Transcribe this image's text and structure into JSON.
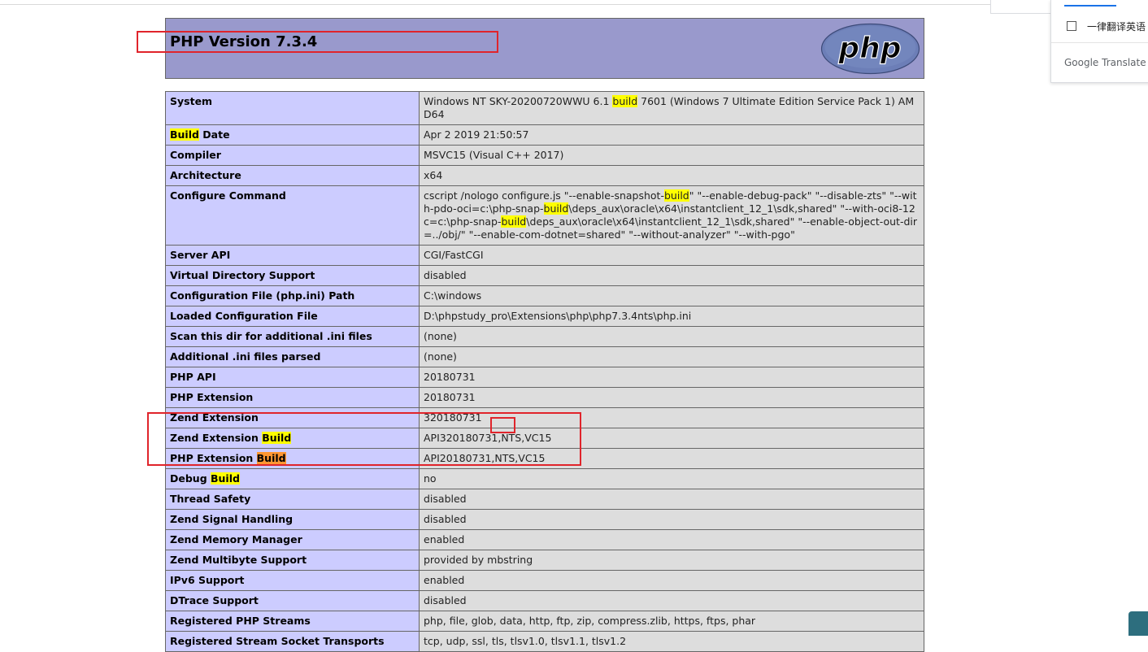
{
  "header": {
    "title": "PHP Version 7.3.4",
    "logo_text": "php"
  },
  "rows": [
    {
      "key": "System",
      "val": [
        {
          "t": "Windows NT SKY-20200720WWU 6.1 "
        },
        {
          "t": "build",
          "h": 1
        },
        {
          "t": " 7601 (Windows 7 Ultimate Edition Service Pack 1) AMD64"
        }
      ]
    },
    {
      "key": [
        {
          "t": "Build",
          "h": 1
        },
        {
          "t": " Date"
        }
      ],
      "val": "Apr 2 2019 21:50:57"
    },
    {
      "key": "Compiler",
      "val": "MSVC15 (Visual C++ 2017)"
    },
    {
      "key": "Architecture",
      "val": "x64"
    },
    {
      "key": "Configure Command",
      "val": [
        {
          "t": "cscript /nologo configure.js \"--enable-snapshot-"
        },
        {
          "t": "build",
          "h": 1
        },
        {
          "t": "\" \"--enable-debug-pack\" \"--disable-zts\" \"--with-pdo-oci=c:\\php-snap-"
        },
        {
          "t": "build",
          "h": 1
        },
        {
          "t": "\\deps_aux\\oracle\\x64\\instantclient_12_1\\sdk,shared\" \"--with-oci8-12c=c:\\php-snap-"
        },
        {
          "t": "build",
          "h": 1
        },
        {
          "t": "\\deps_aux\\oracle\\x64\\instantclient_12_1\\sdk,shared\" \"--enable-object-out-dir=../obj/\" \"--enable-com-dotnet=shared\" \"--without-analyzer\" \"--with-pgo\""
        }
      ]
    },
    {
      "key": "Server API",
      "val": "CGI/FastCGI"
    },
    {
      "key": "Virtual Directory Support",
      "val": "disabled"
    },
    {
      "key": "Configuration File (php.ini) Path",
      "val": "C:\\windows"
    },
    {
      "key": "Loaded Configuration File",
      "val": "D:\\phpstudy_pro\\Extensions\\php\\php7.3.4nts\\php.ini"
    },
    {
      "key": "Scan this dir for additional .ini files",
      "val": "(none)"
    },
    {
      "key": "Additional .ini files parsed",
      "val": "(none)"
    },
    {
      "key": "PHP API",
      "val": "20180731"
    },
    {
      "key": "PHP Extension",
      "val": "20180731"
    },
    {
      "key": "Zend Extension",
      "val": "320180731"
    },
    {
      "key": [
        {
          "t": "Zend Extension "
        },
        {
          "t": "Build",
          "h": 1
        }
      ],
      "val": "API320180731,NTS,VC15"
    },
    {
      "key": [
        {
          "t": "PHP Extension "
        },
        {
          "t": "Build",
          "h": 2
        }
      ],
      "val": "API20180731,NTS,VC15"
    },
    {
      "key": [
        {
          "t": "Debug "
        },
        {
          "t": "Build",
          "h": 1
        }
      ],
      "val": "no"
    },
    {
      "key": "Thread Safety",
      "val": "disabled"
    },
    {
      "key": "Zend Signal Handling",
      "val": "disabled"
    },
    {
      "key": "Zend Memory Manager",
      "val": "enabled"
    },
    {
      "key": "Zend Multibyte Support",
      "val": "provided by mbstring"
    },
    {
      "key": "IPv6 Support",
      "val": "enabled"
    },
    {
      "key": "DTrace Support",
      "val": "disabled"
    },
    {
      "key": "Registered PHP Streams",
      "val": "php, file, glob, data, http, ftp, zip, compress.zlib, https, ftps, phar"
    },
    {
      "key": "Registered Stream Socket Transports",
      "val": "tcp, udp, ssl, tls, tlsv1.0, tlsv1.1, tlsv1.2"
    }
  ],
  "translate_popup": {
    "option_label": "一律翻译英语",
    "brand": "Google Translate"
  },
  "colors": {
    "header_bg": "#9999cc",
    "key_bg": "#ccccff",
    "value_bg": "#dddddd",
    "highlight": "#ffff00",
    "highlight_active": "#ff9632",
    "annotation_red": "#e0242b"
  }
}
